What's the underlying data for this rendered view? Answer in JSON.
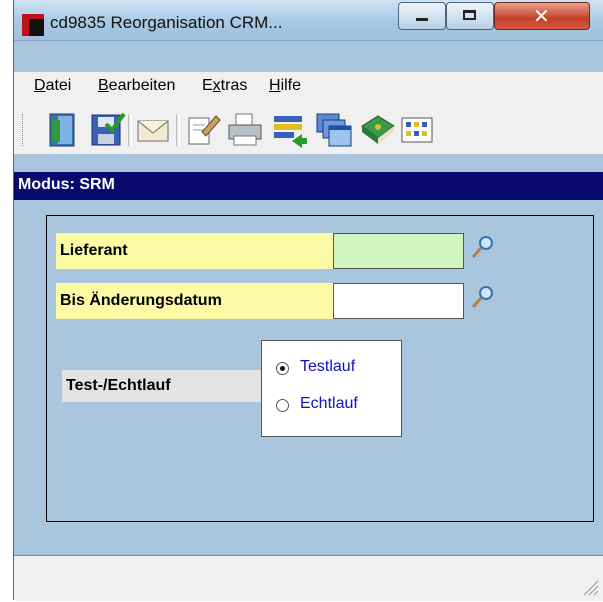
{
  "window": {
    "title": "cd9835 Reorganisation CRM..."
  },
  "menu": [
    {
      "underline": "D",
      "rest": "atei"
    },
    {
      "underline": "B",
      "rest": "earbeiten"
    },
    {
      "prefix": "E",
      "underline": "x",
      "rest": "tras"
    },
    {
      "underline": "H",
      "rest": "ilfe"
    }
  ],
  "toolbar": {
    "icons": [
      "exit-door-icon",
      "save-icon",
      "email-icon",
      "edit-document-icon",
      "print-icon",
      "transfer-list-icon",
      "windows-icon",
      "book-icon",
      "grid-icon"
    ]
  },
  "mode": {
    "label": "Modus: SRM"
  },
  "form": {
    "lieferant_label": "Lieferant",
    "lieferant_value": "",
    "datum_label": "Bis Änderungsdatum",
    "datum_value": "",
    "lauf_label": "Test-/Echtlauf",
    "options": [
      {
        "label": "Testlauf",
        "selected": true
      },
      {
        "label": "Echtlauf",
        "selected": false
      }
    ]
  },
  "colors": {
    "mode_bar": "#0a0a6e",
    "window_bg": "#a9c6de",
    "label_yellow": "#fdfaa6",
    "field_green": "#d0f5c0",
    "radio_text": "#1010c0"
  }
}
